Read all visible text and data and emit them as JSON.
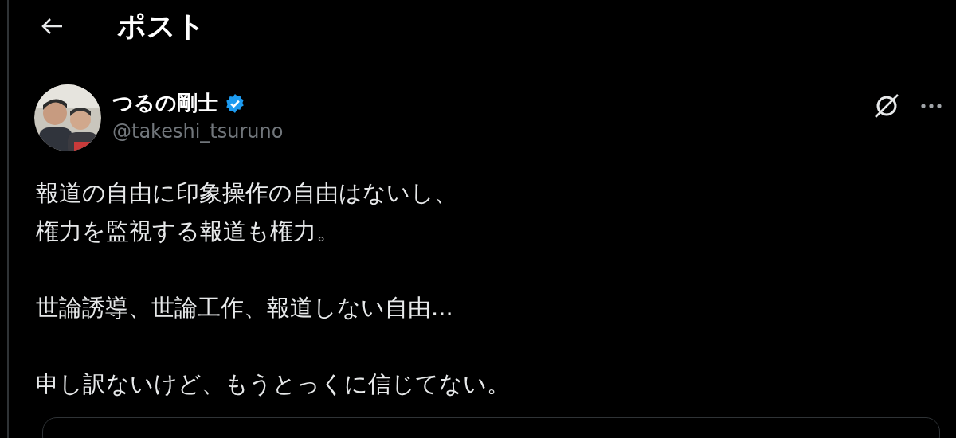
{
  "header": {
    "title": "ポスト"
  },
  "author": {
    "name": "つるの剛士",
    "verified": true,
    "handle": "@takeshi_tsuruno"
  },
  "post": {
    "paragraphs": [
      {
        "lines": [
          "報道の自由に印象操作の自由はないし、",
          "権力を監視する報道も権力。"
        ]
      },
      {
        "lines": [
          "世論誘導、世論工作、報道しない自由..."
        ]
      },
      {
        "lines": [
          "申し訳ないけど、もうとっくに信じてない。"
        ]
      }
    ]
  }
}
